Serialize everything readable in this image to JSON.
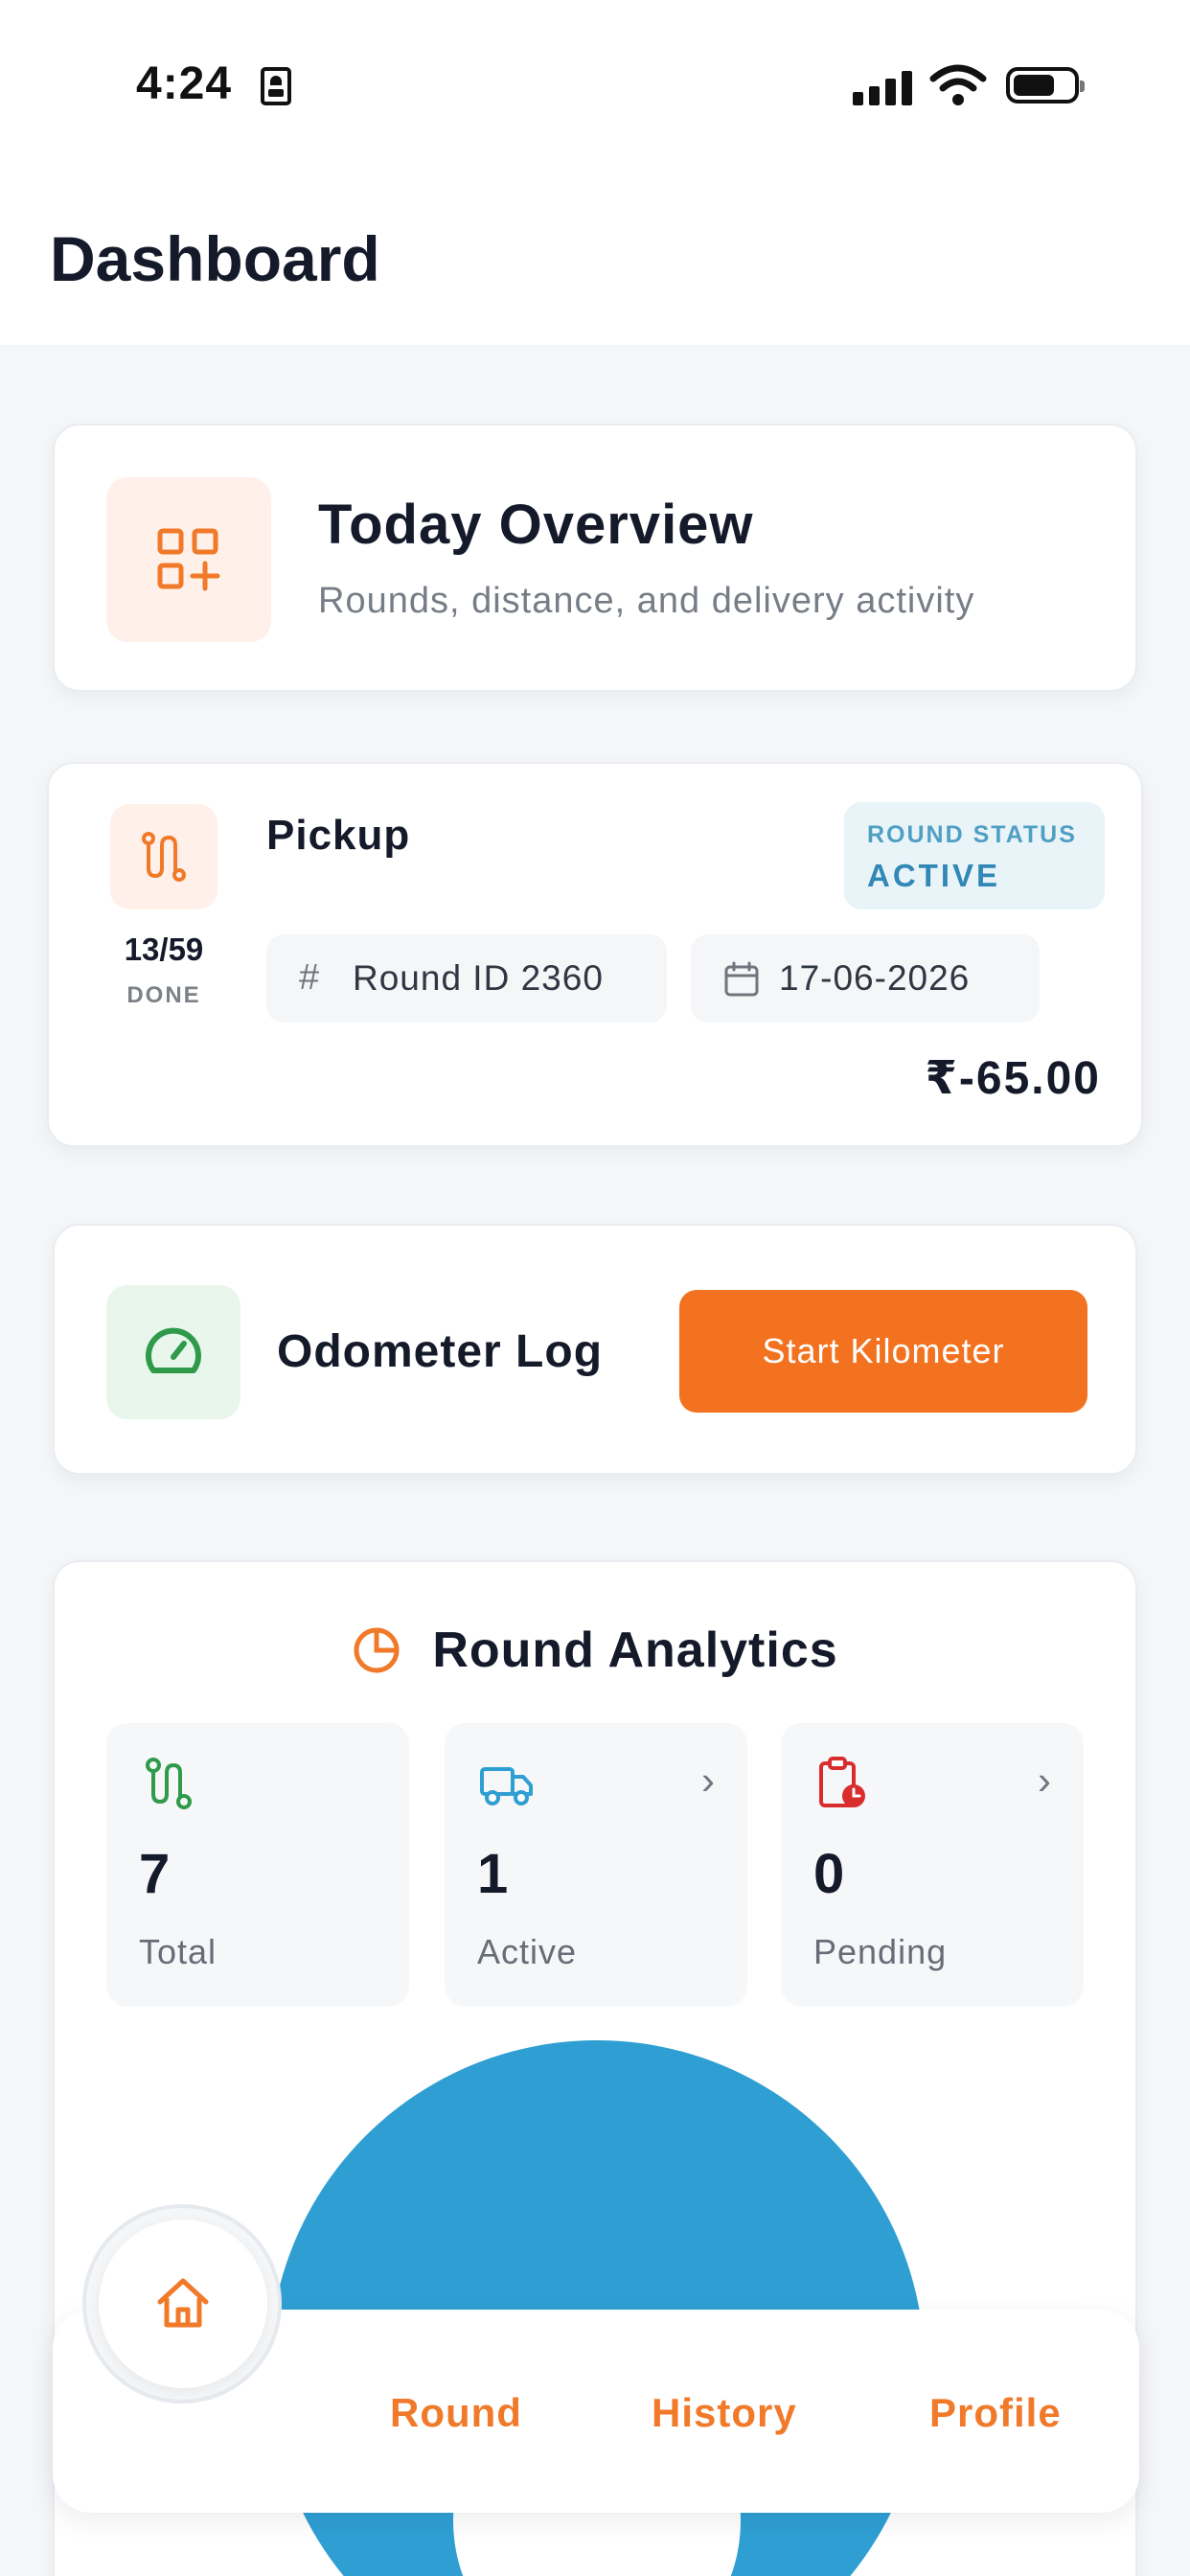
{
  "status_bar": {
    "time": "4:24"
  },
  "header": {
    "title": "Dashboard"
  },
  "overview": {
    "title": "Today Overview",
    "subtitle": "Rounds, distance, and delivery activity"
  },
  "round": {
    "type": "Pickup",
    "done_count": "13/59",
    "done_label": "DONE",
    "status_label": "ROUND STATUS",
    "status_value": "ACTIVE",
    "round_id": "Round ID 2360",
    "date": "17-06-2026",
    "amount": "₹-65.00"
  },
  "odometer": {
    "title": "Odometer Log",
    "button_label": "Start Kilometer"
  },
  "analytics": {
    "title": "Round Analytics",
    "stats": [
      {
        "value": "7",
        "label": "Total"
      },
      {
        "value": "1",
        "label": "Active"
      },
      {
        "value": "0",
        "label": "Pending"
      }
    ]
  },
  "nav": {
    "round": "Round",
    "history": "History",
    "profile": "Profile"
  },
  "colors": {
    "accent": "#f3721f",
    "status_blue": "#3187b6",
    "success_green": "#2f9a4a",
    "pending_red": "#d92d2d",
    "donut_blue": "#2f9fd3"
  }
}
